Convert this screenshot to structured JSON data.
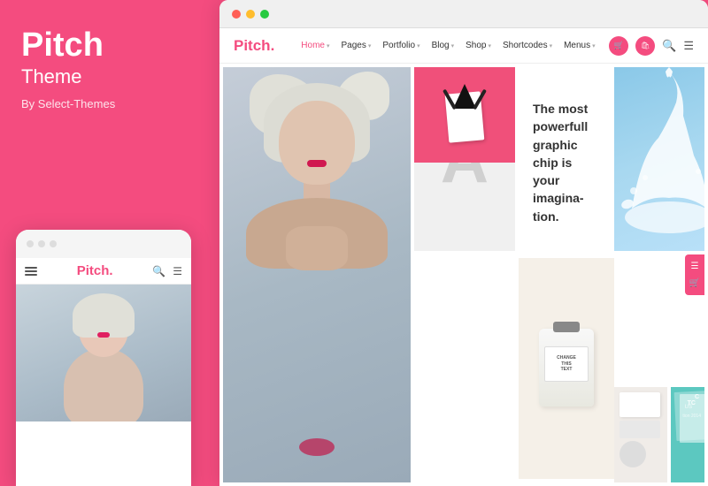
{
  "brand": {
    "name": "Pitch",
    "subtitle": "Theme",
    "by": "By Select-Themes"
  },
  "mobile": {
    "logo": "Pitch",
    "logo_dot": "."
  },
  "desktop": {
    "logo": "Pitch",
    "logo_dot": ".",
    "nav_items": [
      {
        "label": "Home",
        "active": true,
        "has_chevron": true
      },
      {
        "label": "Pages",
        "active": false,
        "has_chevron": true
      },
      {
        "label": "Portfolio",
        "active": false,
        "has_chevron": true
      },
      {
        "label": "Blog",
        "active": false,
        "has_chevron": true
      },
      {
        "label": "Shop",
        "active": false,
        "has_chevron": true
      },
      {
        "label": "Shortcodes",
        "active": false,
        "has_chevron": true
      },
      {
        "label": "Menus",
        "active": false,
        "has_chevron": true
      }
    ]
  },
  "content": {
    "text_block": {
      "line1": "The most",
      "line2": "powerfull",
      "line3": "graphic",
      "line4": "chip is your",
      "line5": "imagina-",
      "line6": "tion."
    },
    "product_label": "CHANGE\nTHIS TEXT"
  },
  "colors": {
    "pink": "#f44c7f",
    "light_blue": "#87ceeb",
    "teal": "#4ecdc4",
    "light_gray": "#f0f0f0",
    "letter_a_color": "#d0d0d0"
  }
}
